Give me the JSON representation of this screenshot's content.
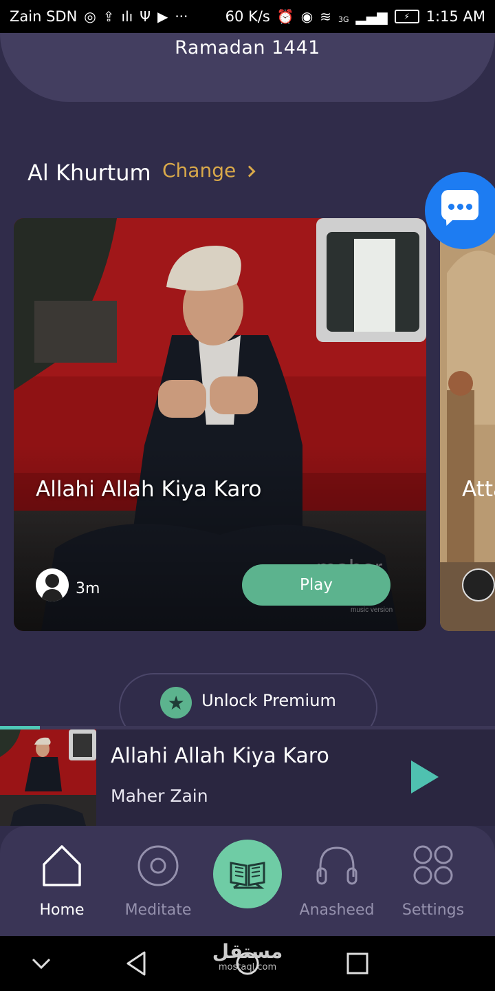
{
  "status_bar": {
    "carrier": "Zain SDN",
    "speed": "60 K/s",
    "network": "3G",
    "time": "1:15 AM"
  },
  "header": {
    "hijri_date": "Ramadan 1441"
  },
  "location": {
    "name": "Al Khurtum",
    "change_label": "Change"
  },
  "cards": [
    {
      "title": "Allahi Allah Kiya Karo",
      "duration": "3m",
      "play_label": "Play",
      "image_caption": "maher",
      "image_subcaption": "music version"
    },
    {
      "title": "Atta"
    }
  ],
  "premium": {
    "label": "Unlock Premium"
  },
  "now_playing": {
    "title": "Allahi Allah Kiya Karo",
    "artist": "Maher Zain",
    "progress": 0.08
  },
  "tabs": [
    {
      "label": "Home",
      "icon": "home-icon",
      "active": true
    },
    {
      "label": "Meditate",
      "icon": "meditate-icon",
      "active": false
    },
    {
      "label": "",
      "icon": "quran-icon",
      "active": false
    },
    {
      "label": "Anasheed",
      "icon": "headphones-icon",
      "active": false
    },
    {
      "label": "Settings",
      "icon": "settings-grid-icon",
      "active": false
    }
  ],
  "watermark": {
    "arabic": "مستقل",
    "latin": "mostaql.com"
  },
  "colors": {
    "background": "#302c4a",
    "accent_green": "#5cb38e",
    "accent_gold": "#d9a94a",
    "chat_blue": "#1d7cf2",
    "progress": "#4ec9b8"
  }
}
